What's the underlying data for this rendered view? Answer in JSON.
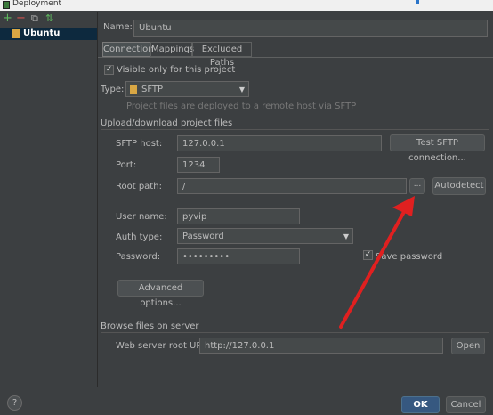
{
  "window": {
    "title": "Deployment"
  },
  "toolbar": {
    "add": "+",
    "remove": "−",
    "copy": "⧉",
    "move": "⇅"
  },
  "servers": [
    {
      "name": "Ubuntu"
    }
  ],
  "name_label": "Name:",
  "name_value": "Ubuntu",
  "tabs": [
    "Connection",
    "Mappings",
    "Excluded Paths"
  ],
  "visible_only": {
    "label": "Visible only for this project",
    "checked": true
  },
  "type": {
    "label": "Type:",
    "value": "SFTP",
    "hint": "Project files are deployed to a remote host via SFTP"
  },
  "upload_section": "Upload/download project files",
  "sftp_host": {
    "label": "SFTP host:",
    "value": "127.0.0.1",
    "test_button": "Test SFTP connection..."
  },
  "port": {
    "label": "Port:",
    "value": "1234"
  },
  "root_path": {
    "label": "Root path:",
    "value": "/",
    "browse": "...",
    "autodetect": "Autodetect"
  },
  "user_name": {
    "label": "User name:",
    "value": "pyvip"
  },
  "auth_type": {
    "label": "Auth type:",
    "value": "Password"
  },
  "password": {
    "label": "Password:",
    "value": "•••••••••",
    "save_label": "Save password",
    "save_checked": true
  },
  "advanced_button": "Advanced options...",
  "browse_section": "Browse files on server",
  "web_root": {
    "label": "Web server root URL:",
    "value": "http://127.0.0.1",
    "open": "Open"
  },
  "footer": {
    "help": "?",
    "ok": "OK",
    "cancel": "Cancel"
  },
  "colors": {
    "background": "#3c3f41",
    "selection": "#0d293e",
    "annotation_arrow": "#e02020",
    "ok_button": "#365880"
  }
}
